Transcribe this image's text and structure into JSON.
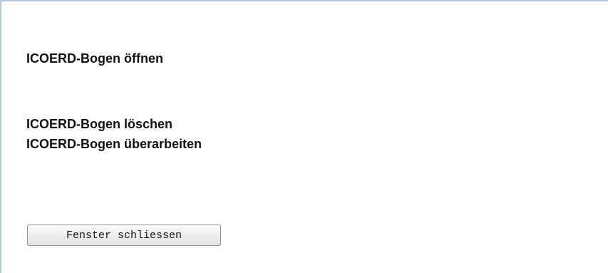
{
  "links": {
    "open": "ICOERD-Bogen öffnen",
    "delete": "ICOERD-Bogen löschen",
    "edit": "ICOERD-Bogen überarbeiten"
  },
  "buttons": {
    "close": "Fenster schliessen"
  },
  "colors": {
    "frame_border": "#b7c7dc",
    "background": "#ffffff",
    "text": "#111111"
  }
}
